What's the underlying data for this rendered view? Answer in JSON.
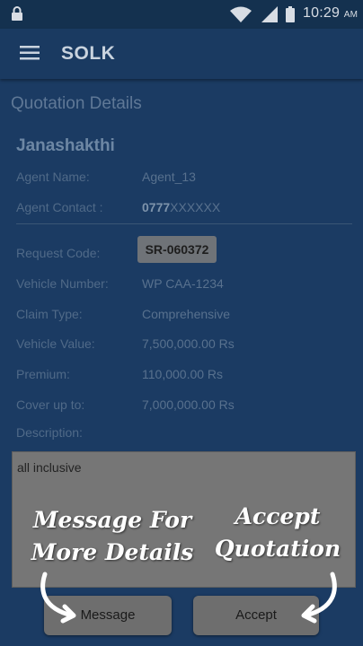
{
  "status_bar": {
    "time": "10:29",
    "ampm": "AM",
    "icons": [
      "lock-icon",
      "wifi-icon",
      "signal-icon",
      "battery-icon"
    ]
  },
  "app_bar": {
    "title": "SOLK",
    "menu_icon": "hamburger-menu-icon"
  },
  "page": {
    "section_title": "Quotation Details",
    "company": "Janashakthi"
  },
  "agent": {
    "name_label": "Agent Name:",
    "name_value": "Agent_13",
    "contact_label": "Agent Contact :",
    "contact_prefix": "0777",
    "contact_rest": "XXXXXX"
  },
  "details": {
    "request_code_label": "Request Code:",
    "request_code_value": "SR-060372",
    "vehicle_number_label": "Vehicle Number:",
    "vehicle_number_value": "WP CAA-1234",
    "claim_type_label": "Claim Type:",
    "claim_type_value": "Comprehensive",
    "vehicle_value_label": "Vehicle Value:",
    "vehicle_value_value": "7,500,000.00 Rs",
    "premium_label": "Premium:",
    "premium_value": "110,000.00 Rs",
    "cover_label": "Cover up to:",
    "cover_value": "7,000,000.00 Rs",
    "description_label": "Description:",
    "description_value": "all inclusive"
  },
  "buttons": {
    "message": "Message",
    "accept": "Accept"
  },
  "annotations": {
    "left_line1": "Message For",
    "left_line2": "More Details",
    "right_line1": "Accept",
    "right_line2": "Quotation"
  },
  "colors": {
    "background": "#1b3b63",
    "status_bar": "#14314f",
    "overlay_grey": "#767676",
    "annotation_text": "#ffffff"
  }
}
